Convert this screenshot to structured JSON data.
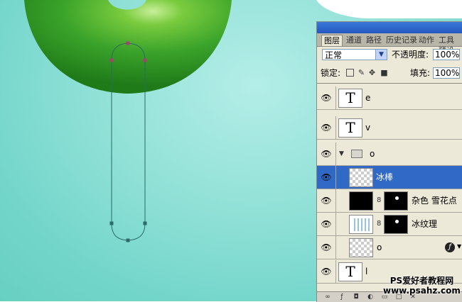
{
  "tabs": [
    "图层",
    "通道",
    "路径",
    "历史记录",
    "动作",
    "工具预设"
  ],
  "blend_mode": {
    "value": "正常",
    "arrow": "chevron-down-icon"
  },
  "opacity": {
    "label": "不透明度:",
    "value": "100%"
  },
  "lock": {
    "label": "锁定:",
    "icons": [
      "lock-transparent-icon",
      "lock-paint-icon",
      "lock-move-icon",
      "lock-all-icon"
    ]
  },
  "fill": {
    "label": "填充:",
    "value": "100%"
  },
  "layers": [
    {
      "name": "e",
      "thumb": "text-T",
      "visible": true,
      "selected": false
    },
    {
      "name": "v",
      "thumb": "text-T",
      "visible": true,
      "selected": false
    },
    {
      "name": "o",
      "thumb": "folder",
      "visible": true,
      "selected": false,
      "expanded": true
    },
    {
      "name": "冰棒",
      "thumb": "transparent",
      "visible": true,
      "selected": true
    },
    {
      "name": "杂色 雪花点",
      "thumb": "black",
      "mask": true,
      "visible": true,
      "selected": false
    },
    {
      "name": "冰纹理",
      "thumb": "texture",
      "mask": true,
      "visible": true,
      "selected": false
    },
    {
      "name": "o",
      "thumb": "transparent",
      "visible": true,
      "selected": false,
      "fx": true
    },
    {
      "name": "l",
      "thumb": "text-T",
      "visible": true,
      "selected": false
    }
  ],
  "text_thumb_glyph": "T",
  "watermark": {
    "line1": "PS爱好者教程网",
    "line2": "www.psahz.com"
  },
  "colors": {
    "canvas_bg": "#8fe0d6",
    "green_shape": "#3aa32a",
    "path_stroke": "#2a6b66",
    "selection": "#3169c6"
  }
}
